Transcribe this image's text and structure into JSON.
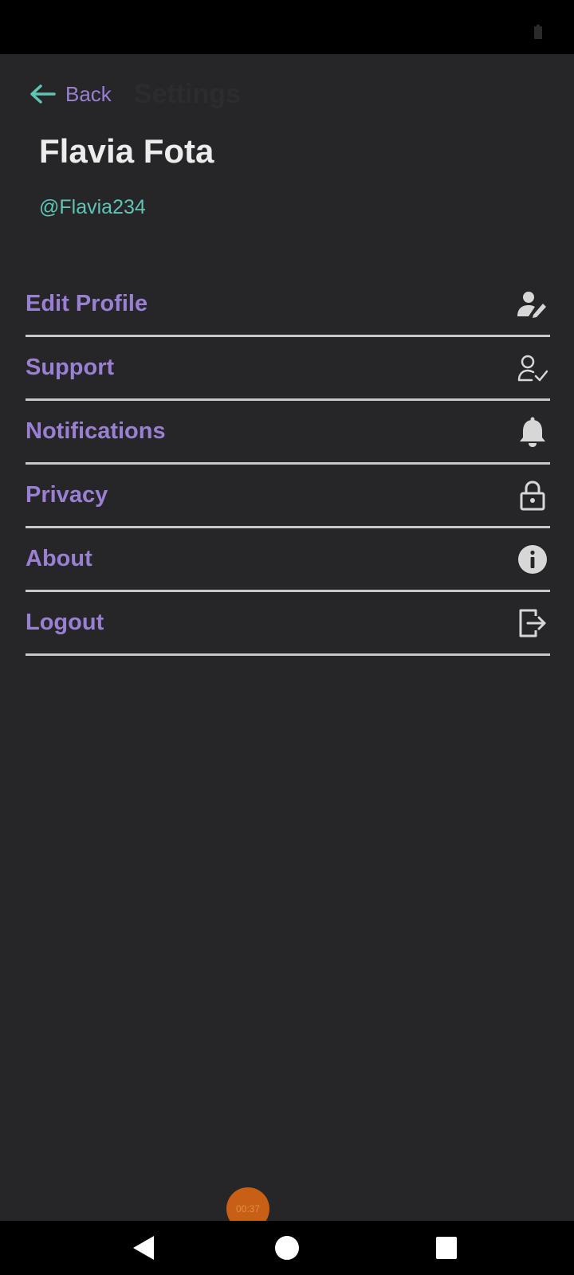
{
  "status_bar": {
    "battery_icon": "battery-icon"
  },
  "header": {
    "back_label": "Back",
    "title": "Settings",
    "back_icon": "arrow-left-icon"
  },
  "profile": {
    "name": "Flavia Fota",
    "handle": "@Flavia234"
  },
  "menu": {
    "items": [
      {
        "label": "Edit Profile",
        "icon": "edit-user-icon"
      },
      {
        "label": "Support",
        "icon": "user-check-icon"
      },
      {
        "label": "Notifications",
        "icon": "bell-icon"
      },
      {
        "label": "Privacy",
        "icon": "lock-icon"
      },
      {
        "label": "About",
        "icon": "info-icon"
      },
      {
        "label": "Logout",
        "icon": "logout-icon"
      }
    ]
  },
  "recording": {
    "time": "00:37"
  },
  "nav_bar": {
    "back_icon": "nav-back-icon",
    "home_icon": "nav-home-icon",
    "recents_icon": "nav-recents-icon"
  },
  "colors": {
    "background": "#262628",
    "accent_purple": "#9a7fd3",
    "accent_teal": "#5fc4b6",
    "divider": "#c8c8c8"
  }
}
